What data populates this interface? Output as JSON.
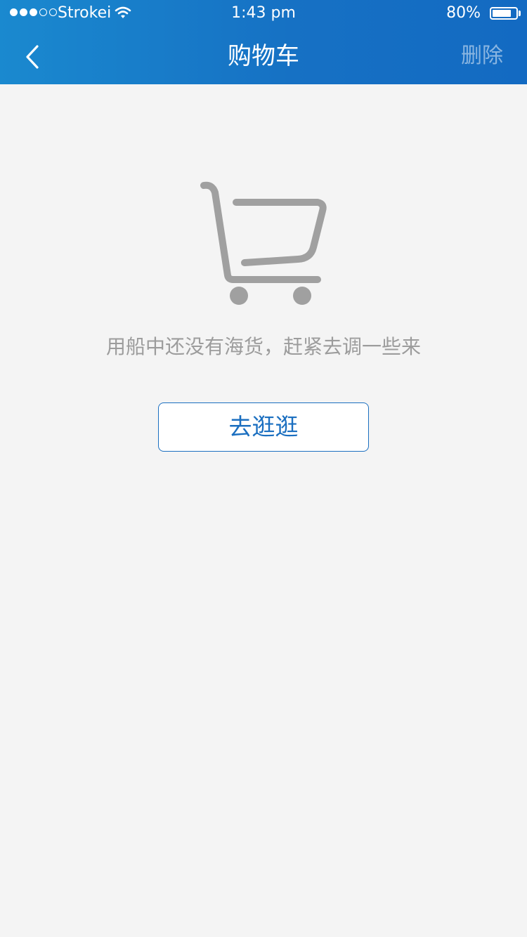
{
  "status_bar": {
    "signal_filled": 3,
    "signal_total": 5,
    "carrier": "Strokei",
    "time": "1:43 pm",
    "battery_percent": "80%",
    "battery_level": 0.8
  },
  "nav": {
    "back_icon": "chevron-left-icon",
    "title": "购物车",
    "delete_label": "删除"
  },
  "empty_state": {
    "icon": "shopping-cart-icon",
    "message": "用船中还没有海货，赶紧去调一些来",
    "button_label": "去逛逛"
  },
  "colors": {
    "header_gradient_start": "#1a89cf",
    "header_gradient_end": "#136ac2",
    "background": "#f4f4f4",
    "accent": "#1b6fc0",
    "icon_gray": "#a0a0a0",
    "message_gray": "#9c9c9c"
  }
}
